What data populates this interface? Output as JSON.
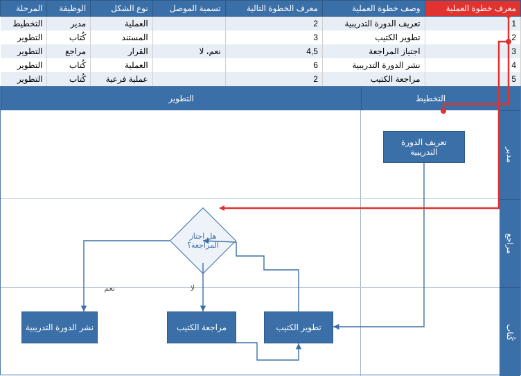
{
  "headers": [
    "معرف خطوة العملية",
    "وصف خطوة العملية",
    "معرف الخطوة التالية",
    "تسمية الموصل",
    "نوع الشكل",
    "الوظيفة",
    "المرحلة"
  ],
  "rows": [
    {
      "id": "1",
      "desc": "تعريف الدورة التدريبية",
      "next": "2",
      "conn": "",
      "shape": "العملية",
      "role": "مدير",
      "phase": "التخطيط"
    },
    {
      "id": "2",
      "desc": "تطوير الكتيب",
      "next": "3",
      "conn": "",
      "shape": "المستند",
      "role": "كُتاب",
      "phase": "التطوير"
    },
    {
      "id": "3",
      "desc": "اجتياز المراجعة",
      "next": "4,5",
      "conn": "نعم، لا",
      "shape": "القرار",
      "role": "مراجع",
      "phase": "التطوير"
    },
    {
      "id": "4",
      "desc": "نشر الدورة التدريبية",
      "next": "6",
      "conn": "",
      "shape": "العملية",
      "role": "كُتاب",
      "phase": "التطوير"
    },
    {
      "id": "5",
      "desc": "مراجعة الكتيب",
      "next": "2",
      "conn": "",
      "shape": "عملية فرعية",
      "role": "كُتاب",
      "phase": "التطوير"
    }
  ],
  "phases": {
    "plan": "التخطيط",
    "dev": "التطوير"
  },
  "lanes": {
    "mgr": "مدير",
    "rev": "مراجع",
    "wri": "كُتاب"
  },
  "nodes": {
    "n1": "تعريف الدورة التدريبية",
    "n2": "تطوير الكتيب",
    "n3": "هل اجتاز المراجعة؟",
    "n4": "نشر الدورة التدريبية",
    "n5": "مراجعة الكتيب"
  },
  "edge": {
    "yes": "نعم",
    "no": "لا"
  }
}
